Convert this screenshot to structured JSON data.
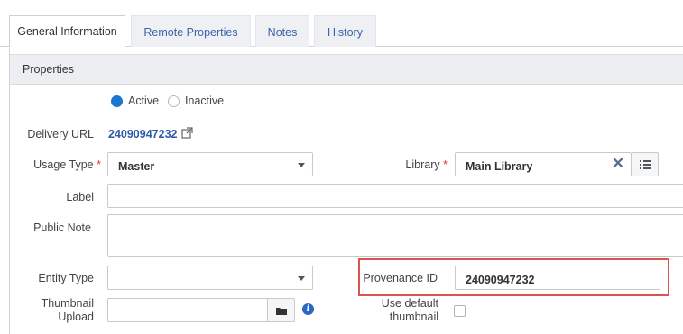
{
  "tabs": [
    {
      "label": "General Information",
      "active": true
    },
    {
      "label": "Remote Properties",
      "active": false
    },
    {
      "label": "Notes",
      "active": false
    },
    {
      "label": "History",
      "active": false
    }
  ],
  "section": {
    "title": "Properties"
  },
  "status": {
    "active_label": "Active",
    "inactive_label": "Inactive",
    "selected": "Active"
  },
  "delivery_url": {
    "label": "Delivery URL",
    "value": "24090947232",
    "icon": "external-link-icon"
  },
  "usage_type": {
    "label": "Usage Type",
    "required_mark": "*",
    "value": "Master"
  },
  "library": {
    "label": "Library",
    "required_mark": "*",
    "value": "Main Library"
  },
  "label_field": {
    "label": "Label",
    "value": ""
  },
  "public_note": {
    "label": "Public Note",
    "value": ""
  },
  "entity_type": {
    "label": "Entity Type",
    "value": ""
  },
  "provenance_id": {
    "label": "Provenance ID",
    "value": "24090947232"
  },
  "thumbnail_upload": {
    "label_line1": "Thumbnail",
    "label_line2": "Upload",
    "value": ""
  },
  "default_thumbnail": {
    "label_line1": "Use default",
    "label_line2": "thumbnail",
    "checked": false
  },
  "colors": {
    "accent": "#1b78d0",
    "link": "#2e5aa8",
    "required": "#d9363e",
    "highlight": "#d9534f"
  }
}
